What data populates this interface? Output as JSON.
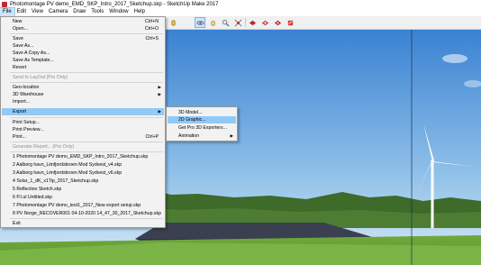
{
  "window": {
    "title": "Photomontage PV demo_EMD_SKP_Intro_2017_Sketchup.skp - SketchUp Make 2017"
  },
  "menubar": [
    "File",
    "Edit",
    "View",
    "Camera",
    "Draw",
    "Tools",
    "Window",
    "Help"
  ],
  "toolbar": {
    "icons": [
      "hand-select-icon",
      "orbit-icon",
      "pan-icon",
      "zoom-icon",
      "zoom-extents-icon",
      "warehouse-icon",
      "share-model-icon",
      "extension-warehouse-icon",
      "layout-icon"
    ]
  },
  "file_menu": {
    "items": [
      {
        "label": "New",
        "shortcut": "Ctrl+N"
      },
      {
        "label": "Open...",
        "shortcut": "Ctrl+O"
      },
      {
        "label": "Save",
        "shortcut": "Ctrl+S"
      },
      {
        "label": "Save As..."
      },
      {
        "label": "Save A Copy As..."
      },
      {
        "label": "Save As Template..."
      },
      {
        "label": "Revert"
      },
      {
        "label": "Send to LayOut (Pro Only)",
        "disabled": true
      },
      {
        "label": "Geo-location",
        "submenu": true
      },
      {
        "label": "3D Warehouse",
        "submenu": true
      },
      {
        "label": "Import..."
      },
      {
        "label": "Export",
        "submenu": true,
        "highlighted": true
      },
      {
        "label": "Print Setup..."
      },
      {
        "label": "Print Preview..."
      },
      {
        "label": "Print...",
        "shortcut": "Ctrl+P"
      },
      {
        "label": "Generate Report... (Pro Only)",
        "disabled": true
      },
      {
        "label": "1 Photomontage PV demo_EMD_SKP_Intro_2017_Sketchup.skp"
      },
      {
        "label": "2 Aalborg havn_Limfjordsbroen Mod Sydvest_v4.skp"
      },
      {
        "label": "3 Aalborg havn_Limfjordsbroen Mod Sydvest_v6.skp"
      },
      {
        "label": "4 Solar_1_dK_x1Tip_2017_Sketchup.skp"
      },
      {
        "label": "5 Reflection Sketch.skp"
      },
      {
        "label": "6 P.I.ul Untitled.skp"
      },
      {
        "label": "7 Photomontage PV demo_test1_2017_New export setup.skp"
      },
      {
        "label": "8 PV Norge_RECOVER001 04-10-2020 14_47_30_2017_Sketchup.skp"
      },
      {
        "label": "Exit"
      }
    ]
  },
  "export_submenu": {
    "items": [
      {
        "label": "3D Model..."
      },
      {
        "label": "2D Graphic...",
        "highlighted": true
      },
      {
        "label": "Get Pro 3D Exporters..."
      },
      {
        "label": "Animation",
        "submenu": true
      }
    ]
  },
  "colors": {
    "menu_highlight": "#91c9f7",
    "sky_top": "#3f86d3",
    "sky_bottom": "#cfe4f5",
    "grass": "#6da83a",
    "panels": "#3b4050"
  }
}
